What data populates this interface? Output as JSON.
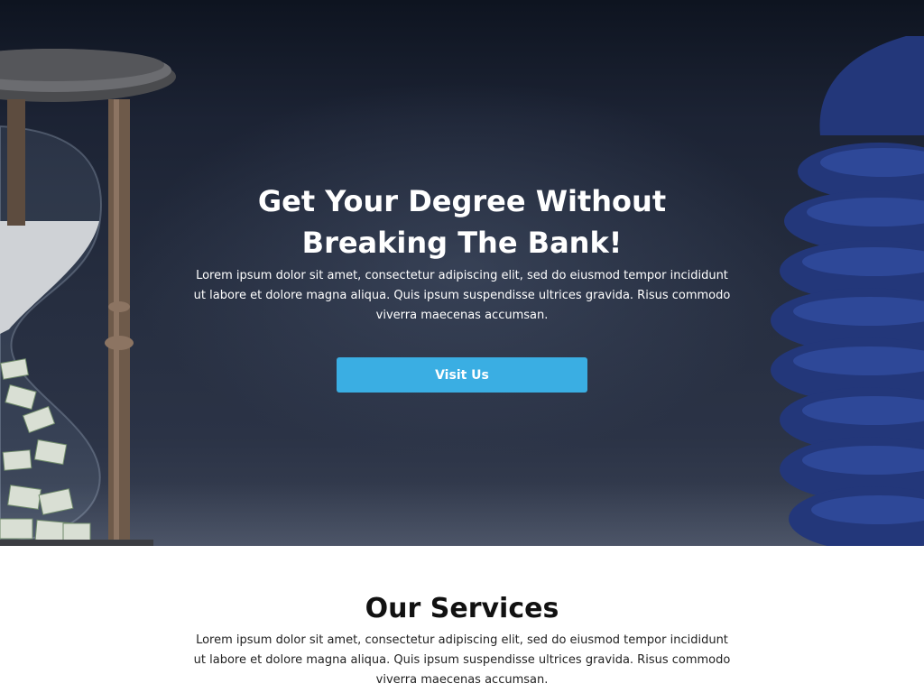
{
  "hero": {
    "title": "Get Your Degree Without Breaking The Bank!",
    "text": "Lorem ipsum dolor sit amet, consectetur adipiscing elit, sed do eiusmod tempor incididunt ut labore et dolore magna aliqua. Quis ipsum suspendisse ultrices gravida. Risus commodo viverra maecenas accumsan.",
    "button_label": "Visit Us",
    "colors": {
      "button": "#3aaee3",
      "background": "#1c2334"
    }
  },
  "services": {
    "title": "Our Services",
    "text": "Lorem ipsum dolor sit amet, consectetur adipiscing elit, sed do eiusmod tempor incididunt ut labore et dolore magna aliqua. Quis ipsum suspendisse ultrices gravida. Risus commodo viverra maecenas accumsan."
  },
  "icons": {
    "left_decoration": "hourglass-money-icon",
    "right_decoration": "blue-coin-stack-icon"
  }
}
